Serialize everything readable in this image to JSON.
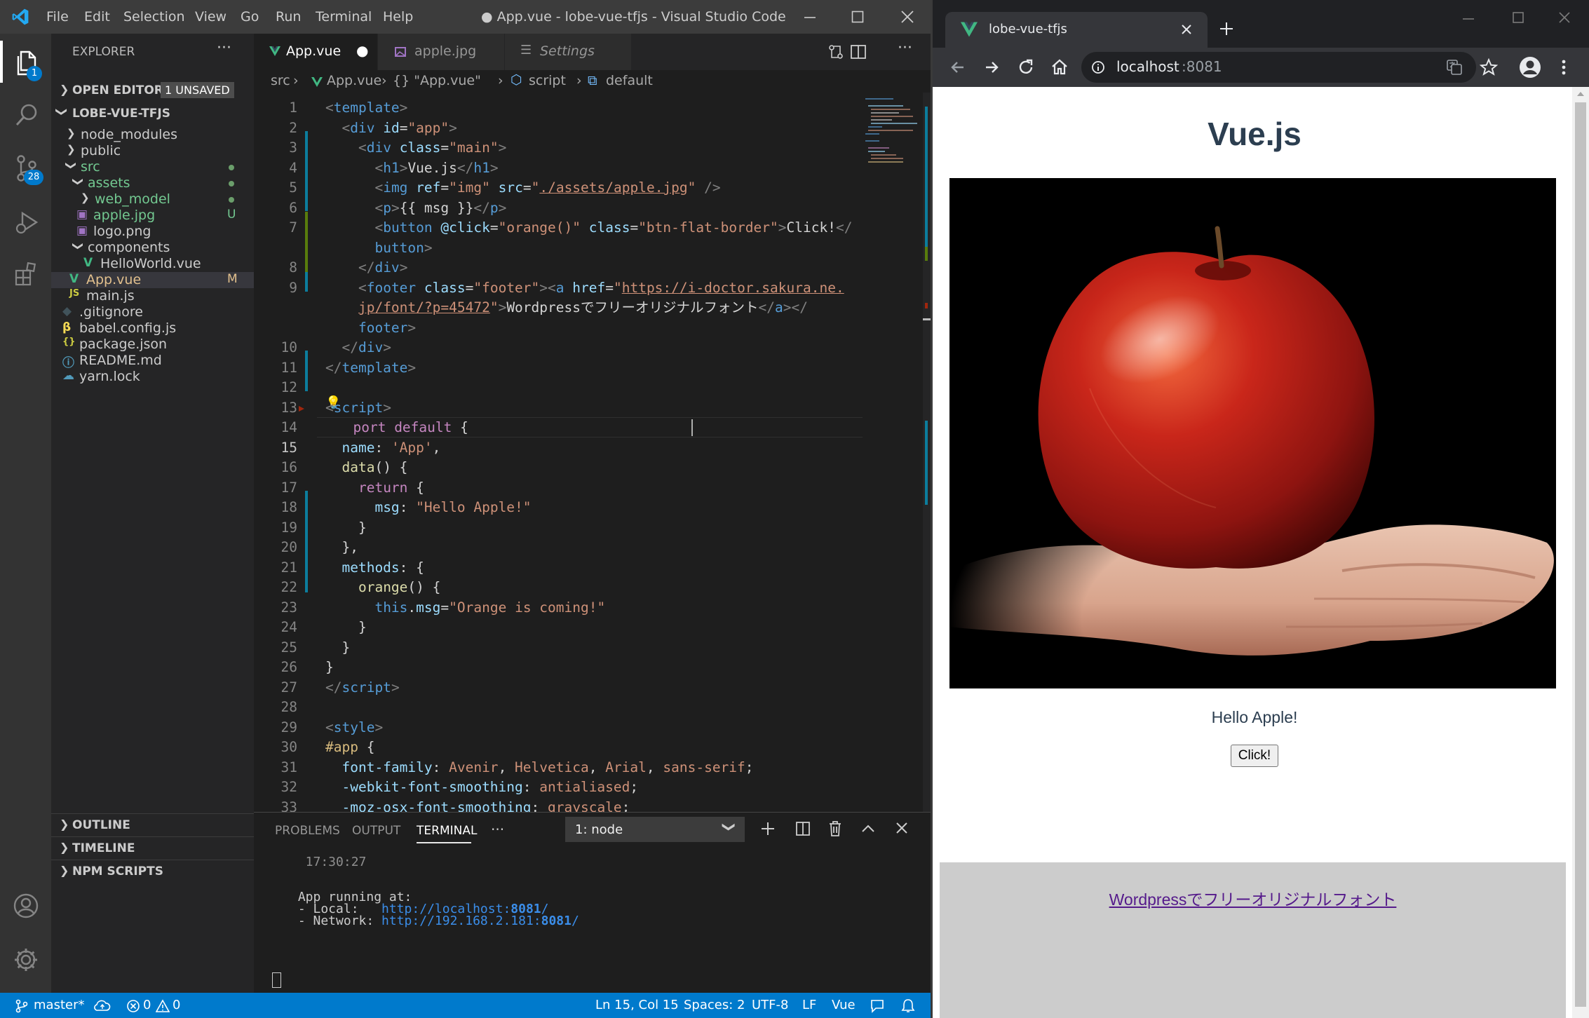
{
  "vscode": {
    "title": "● App.vue - lobe-vue-tfjs - Visual Studio Code",
    "menu": [
      "File",
      "Edit",
      "Selection",
      "View",
      "Go",
      "Run",
      "Terminal",
      "Help"
    ],
    "activity": {
      "explorer_badge": "1",
      "scm_badge": "28"
    },
    "explorer": {
      "header": "EXPLORER",
      "open_editors": "OPEN EDITORS",
      "unsaved_badge": "1 UNSAVED",
      "project": "LOBE-VUE-TFJS",
      "tree": [
        {
          "name": "node_modules",
          "type": "folder",
          "level": 1,
          "status": ""
        },
        {
          "name": "public",
          "type": "folder",
          "level": 1,
          "status": ""
        },
        {
          "name": "src",
          "type": "folder-open",
          "level": 1,
          "status": "dot"
        },
        {
          "name": "assets",
          "type": "folder-open",
          "level": 2,
          "status": "dot"
        },
        {
          "name": "web_model",
          "type": "folder",
          "level": 3,
          "status": "dot"
        },
        {
          "name": "apple.jpg",
          "type": "image",
          "level": 2,
          "status": "U"
        },
        {
          "name": "logo.png",
          "type": "image",
          "level": 2,
          "status": ""
        },
        {
          "name": "components",
          "type": "folder-open",
          "level": 2,
          "status": ""
        },
        {
          "name": "HelloWorld.vue",
          "type": "vue",
          "level": 3,
          "status": ""
        },
        {
          "name": "App.vue",
          "type": "vue",
          "level": 1,
          "status": "M"
        },
        {
          "name": "main.js",
          "type": "js",
          "level": 1,
          "status": ""
        },
        {
          "name": ".gitignore",
          "type": "git",
          "level": 0,
          "status": ""
        },
        {
          "name": "babel.config.js",
          "type": "babel",
          "level": 0,
          "status": ""
        },
        {
          "name": "package.json",
          "type": "json",
          "level": 0,
          "status": ""
        },
        {
          "name": "README.md",
          "type": "info",
          "level": 0,
          "status": ""
        },
        {
          "name": "yarn.lock",
          "type": "yarn",
          "level": 0,
          "status": ""
        }
      ],
      "outline": "OUTLINE",
      "timeline": "TIMELINE",
      "npm": "NPM SCRIPTS"
    },
    "tabs": [
      {
        "label": "App.vue",
        "modified": "●"
      },
      {
        "label": "apple.jpg",
        "modified": ""
      },
      {
        "label": "Settings",
        "modified": ""
      }
    ],
    "breadcrumb": [
      "src",
      "App.vue",
      "{} \"App.vue\"",
      "script",
      "default"
    ],
    "code": [
      {
        "n": "1",
        "t": [
          [
            "t-pun",
            "<"
          ],
          [
            "t-tag",
            "template"
          ],
          [
            "t-pun",
            ">"
          ]
        ]
      },
      {
        "n": "2",
        "t": [
          [
            "",
            "  "
          ],
          [
            "t-pun",
            "<"
          ],
          [
            "t-tag",
            "div "
          ],
          [
            "t-attr",
            "id"
          ],
          [
            "",
            "="
          ],
          [
            "t-str",
            "\"app\""
          ],
          [
            "t-pun",
            ">"
          ]
        ]
      },
      {
        "n": "3",
        "t": [
          [
            "",
            "    "
          ],
          [
            "t-pun",
            "<"
          ],
          [
            "t-tag",
            "div "
          ],
          [
            "t-attr",
            "class"
          ],
          [
            "",
            "="
          ],
          [
            "t-str",
            "\"main\""
          ],
          [
            "t-pun",
            ">"
          ]
        ]
      },
      {
        "n": "4",
        "t": [
          [
            "",
            "      "
          ],
          [
            "t-pun",
            "<"
          ],
          [
            "t-tag",
            "h1"
          ],
          [
            "t-pun",
            ">"
          ],
          [
            "",
            "Vue.js"
          ],
          [
            "t-pun",
            "</"
          ],
          [
            "t-tag",
            "h1"
          ],
          [
            "t-pun",
            ">"
          ]
        ]
      },
      {
        "n": "5",
        "t": [
          [
            "",
            "      "
          ],
          [
            "t-pun",
            "<"
          ],
          [
            "t-tag",
            "img "
          ],
          [
            "t-attr",
            "ref"
          ],
          [
            "",
            "="
          ],
          [
            "t-str",
            "\"img\" "
          ],
          [
            "t-attr",
            "src"
          ],
          [
            "",
            "="
          ],
          [
            "t-str",
            "\""
          ],
          [
            "t-str u",
            "./assets/apple.jpg"
          ],
          [
            "t-str",
            "\" "
          ],
          [
            "t-pun",
            "/>"
          ]
        ]
      },
      {
        "n": "6",
        "t": [
          [
            "",
            "      "
          ],
          [
            "t-pun",
            "<"
          ],
          [
            "t-tag",
            "p"
          ],
          [
            "t-pun",
            ">"
          ],
          [
            "",
            "{{ msg }}"
          ],
          [
            "t-pun",
            "</"
          ],
          [
            "t-tag",
            "p"
          ],
          [
            "t-pun",
            ">"
          ]
        ]
      },
      {
        "n": "7",
        "t": [
          [
            "",
            "      "
          ],
          [
            "t-pun",
            "<"
          ],
          [
            "t-tag",
            "button "
          ],
          [
            "t-attr",
            "@click"
          ],
          [
            "",
            "="
          ],
          [
            "t-str",
            "\"orange()\" "
          ],
          [
            "t-attr",
            "class"
          ],
          [
            "",
            "="
          ],
          [
            "t-str",
            "\"btn-flat-border\""
          ],
          [
            "t-pun",
            ">"
          ],
          [
            "",
            "Click!"
          ],
          [
            "t-pun",
            "</"
          ]
        ]
      },
      {
        "n": "",
        "t": [
          [
            "",
            "      "
          ],
          [
            "t-tag",
            "button"
          ],
          [
            "t-pun",
            ">"
          ]
        ]
      },
      {
        "n": "8",
        "t": [
          [
            "",
            "    "
          ],
          [
            "t-pun",
            "</"
          ],
          [
            "t-tag",
            "div"
          ],
          [
            "t-pun",
            ">"
          ]
        ]
      },
      {
        "n": "9",
        "t": [
          [
            "",
            "    "
          ],
          [
            "t-pun",
            "<"
          ],
          [
            "t-tag",
            "footer "
          ],
          [
            "t-attr",
            "class"
          ],
          [
            "",
            "="
          ],
          [
            "t-str",
            "\"footer\""
          ],
          [
            "t-pun",
            "><"
          ],
          [
            "t-tag",
            "a "
          ],
          [
            "t-attr",
            "href"
          ],
          [
            "",
            "="
          ],
          [
            "t-str",
            "\""
          ],
          [
            "t-str u",
            "https://i-doctor.sakura.ne."
          ]
        ]
      },
      {
        "n": "",
        "t": [
          [
            "",
            "    "
          ],
          [
            "t-str u",
            "jp/font/?p=45472"
          ],
          [
            "t-str",
            "\""
          ],
          [
            "t-pun",
            ">"
          ],
          [
            "",
            "Wordpressでフリーオリジナルフォント"
          ],
          [
            "t-pun",
            "</"
          ],
          [
            "t-tag",
            "a"
          ],
          [
            "t-pun",
            "></"
          ]
        ]
      },
      {
        "n": "",
        "t": [
          [
            "",
            "    "
          ],
          [
            "t-tag",
            "footer"
          ],
          [
            "t-pun",
            ">"
          ]
        ]
      },
      {
        "n": "10",
        "t": [
          [
            "",
            "  "
          ],
          [
            "t-pun",
            "</"
          ],
          [
            "t-tag",
            "div"
          ],
          [
            "t-pun",
            ">"
          ]
        ]
      },
      {
        "n": "11",
        "t": [
          [
            "t-pun",
            "</"
          ],
          [
            "t-tag",
            "template"
          ],
          [
            "t-pun",
            ">"
          ]
        ]
      },
      {
        "n": "12",
        "t": []
      },
      {
        "n": "13",
        "t": [
          [
            "t-pun",
            "<"
          ],
          [
            "t-tag",
            "script"
          ],
          [
            "t-pun",
            ">"
          ]
        ]
      },
      {
        "n": "14",
        "t": [
          [
            "",
            "  "
          ],
          [
            "t-kw",
            "port "
          ],
          [
            "t-kw",
            "default "
          ],
          [
            "",
            "{"
          ]
        ]
      },
      {
        "n": "15",
        "t": [
          [
            "",
            "  "
          ],
          [
            "t-prop",
            "name"
          ],
          [
            "",
            ": "
          ],
          [
            "t-str",
            "'App'"
          ],
          [
            "",
            ","
          ]
        ]
      },
      {
        "n": "16",
        "t": [
          [
            "",
            "  "
          ],
          [
            "t-fn",
            "data"
          ],
          [
            "",
            "() {"
          ]
        ]
      },
      {
        "n": "17",
        "t": [
          [
            "",
            "    "
          ],
          [
            "t-kw",
            "return "
          ],
          [
            "",
            "{"
          ]
        ]
      },
      {
        "n": "18",
        "t": [
          [
            "",
            "      "
          ],
          [
            "t-prop",
            "msg"
          ],
          [
            "",
            ": "
          ],
          [
            "t-str",
            "\"Hello Apple!\""
          ]
        ]
      },
      {
        "n": "19",
        "t": [
          [
            "",
            "    }"
          ]
        ]
      },
      {
        "n": "20",
        "t": [
          [
            "",
            "  },"
          ]
        ]
      },
      {
        "n": "21",
        "t": [
          [
            "",
            "  "
          ],
          [
            "t-prop",
            "methods"
          ],
          [
            "",
            ": {"
          ]
        ]
      },
      {
        "n": "22",
        "t": [
          [
            "",
            "    "
          ],
          [
            "t-fn",
            "orange"
          ],
          [
            "",
            "() {"
          ]
        ]
      },
      {
        "n": "23",
        "t": [
          [
            "",
            "      "
          ],
          [
            "t-blue",
            "this"
          ],
          [
            "",
            "."
          ],
          [
            "t-prop",
            "msg"
          ],
          [
            "",
            "="
          ],
          [
            "t-str",
            "\"Orange is coming!\""
          ]
        ]
      },
      {
        "n": "24",
        "t": [
          [
            "",
            "    }"
          ]
        ]
      },
      {
        "n": "25",
        "t": [
          [
            "",
            "  }"
          ]
        ]
      },
      {
        "n": "26",
        "t": [
          [
            "",
            "}"
          ]
        ]
      },
      {
        "n": "27",
        "t": [
          [
            "t-pun",
            "</"
          ],
          [
            "t-tag",
            "script"
          ],
          [
            "t-pun",
            ">"
          ]
        ]
      },
      {
        "n": "28",
        "t": []
      },
      {
        "n": "29",
        "t": [
          [
            "t-pun",
            "<"
          ],
          [
            "t-tag",
            "style"
          ],
          [
            "t-pun",
            ">"
          ]
        ]
      },
      {
        "n": "30",
        "t": [
          [
            "t-sel",
            "#app "
          ],
          [
            "",
            "{"
          ]
        ]
      },
      {
        "n": "31",
        "t": [
          [
            "",
            "  "
          ],
          [
            "t-prop",
            "font-family"
          ],
          [
            "",
            ": "
          ],
          [
            "t-str",
            "Avenir"
          ],
          [
            "",
            ", "
          ],
          [
            "t-str",
            "Helvetica"
          ],
          [
            "",
            ", "
          ],
          [
            "t-str",
            "Arial"
          ],
          [
            "",
            ", "
          ],
          [
            "t-str",
            "sans-serif"
          ],
          [
            "",
            ";"
          ]
        ]
      },
      {
        "n": "32",
        "t": [
          [
            "",
            "  "
          ],
          [
            "t-prop",
            "-webkit-font-smoothing"
          ],
          [
            "",
            ": "
          ],
          [
            "t-str",
            "antialiased"
          ],
          [
            "",
            ";"
          ]
        ]
      },
      {
        "n": "33",
        "t": [
          [
            "",
            "  "
          ],
          [
            "t-prop",
            "-moz-osx-font-smoothing"
          ],
          [
            "",
            ": "
          ],
          [
            "t-str",
            "grayscale"
          ],
          [
            "",
            ";"
          ]
        ]
      }
    ],
    "panel": {
      "tabs": [
        "PROBLEMS",
        "OUTPUT",
        "TERMINAL",
        "···"
      ],
      "terminal_select": "1: node",
      "lines": [
        {
          "text": "  17:30:27",
          "cls": "dim"
        },
        {
          "text": "",
          "cls": ""
        },
        {
          "text": "",
          "cls": ""
        },
        {
          "text": " App running at:",
          "cls": ""
        },
        {
          "text": " - Local:   ",
          "link": "http://localhost:",
          "bold": "8081",
          "tail": "/"
        },
        {
          "text": " - Network: ",
          "link": "http://192.168.2.181:",
          "bold": "8081",
          "tail": "/"
        }
      ]
    },
    "status": {
      "branch": "master*",
      "errors": "0",
      "warnings": "0",
      "position": "Ln 15, Col 15",
      "spaces": "Spaces: 2",
      "encoding": "UTF-8",
      "eol": "LF",
      "language": "Vue"
    }
  },
  "browser": {
    "tab_title": "lobe-vue-tfjs",
    "url_host": "localhost",
    "url_port": ":8081",
    "page": {
      "heading": "Vue.js",
      "message": "Hello Apple!",
      "button": "Click!",
      "footer_link": "Wordpressでフリーオリジナルフォント"
    }
  },
  "colors": {
    "vscode_blue": "#007acc",
    "activity_bg": "#333333",
    "sidebar_bg": "#252526",
    "editor_bg": "#1e1e1e",
    "vue_green": "#41b883",
    "heading": "#2c3e50",
    "footer_bg": "#cccccc"
  }
}
